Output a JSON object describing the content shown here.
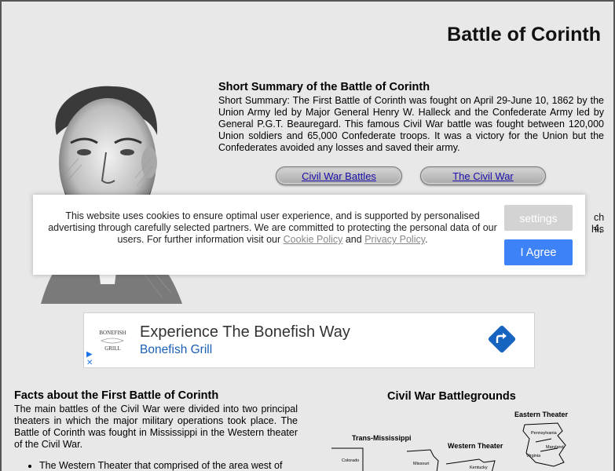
{
  "page": {
    "title": "Battle of Corinth"
  },
  "summary": {
    "heading": "Short Summary of the Battle of Corinth",
    "text": "Short Summary: The First Battle of Corinth was fought on April 29-June 10, 1862 by the Union Army led by Major General Henry W. Halleck and the Confederate Army led by General P.G.T. Beauregard. This famous Civil War battle was fought between 120,000 Union soldiers and 65,000 Confederate troops. It was a victory for the Union but the Confederates avoided any losses and saved their army."
  },
  "nav_buttons": [
    {
      "label": "Civil War Battles"
    },
    {
      "label": "The Civil War"
    }
  ],
  "obscured": {
    "right_text_1": "ch 4,",
    "right_text_2": "his"
  },
  "cookie_banner": {
    "text_before": "This website uses cookies to ensure optimal user experience, and is supported by personalised advertising through carefully selected partners. We are committed to protecting the personal data of our users. For further information visit our ",
    "cookie_link": "Cookie Policy",
    "and": " and ",
    "privacy_link": "Privacy Policy",
    "period": ".",
    "settings_label": "settings",
    "agree_label": "I Agree"
  },
  "ad": {
    "title": "Experience The Bonefish Way",
    "subtitle": "Bonefish Grill",
    "logo_text_1": "BONEFISH",
    "logo_text_2": "GRILL"
  },
  "facts": {
    "heading": "Facts about the First Battle of Corinth",
    "text": "The main battles of the Civil War were divided into two principal theaters in which the major military operations took place. The Battle of Corinth was fought in Mississippi in the Western theater of the Civil War.",
    "bullet_1": "The Western Theater that comprised of the area west of"
  },
  "map": {
    "title": "Civil War Battlegrounds",
    "labels": {
      "eastern": "Eastern Theater",
      "trans": "Trans-Mississippi",
      "western": "Western Theater",
      "colorado": "Colorado",
      "missouri": "Missouri",
      "kentucky": "Kentucky",
      "pennsylvania": "Pennsylvania",
      "maryland": "Maryland",
      "virginia": "Virginia"
    }
  },
  "colors": {
    "accent": "#3e82f7",
    "settings_button": "#d3d3d3",
    "link": "#1a0dab",
    "background": "#e8e8e8"
  }
}
